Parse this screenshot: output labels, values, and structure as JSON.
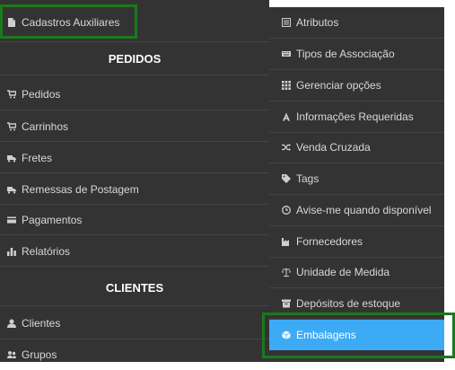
{
  "left_menu": {
    "top_item": {
      "label": "Cadastros Auxiliares",
      "icon": "document-icon"
    },
    "sections": [
      {
        "title": "PEDIDOS",
        "items": [
          {
            "label": "Pedidos",
            "icon": "cart-icon"
          },
          {
            "label": "Carrinhos",
            "icon": "cart-icon"
          },
          {
            "label": "Fretes",
            "icon": "truck-icon"
          },
          {
            "label": "Remessas de Postagem",
            "icon": "truck-icon"
          },
          {
            "label": "Pagamentos",
            "icon": "credit-card-icon"
          },
          {
            "label": "Relatórios",
            "icon": "bar-chart-icon"
          }
        ]
      },
      {
        "title": "CLIENTES",
        "items": [
          {
            "label": "Clientes",
            "icon": "user-icon"
          },
          {
            "label": "Grupos",
            "icon": "users-icon"
          }
        ]
      }
    ]
  },
  "submenu": {
    "items": [
      {
        "label": "Atributos",
        "icon": "list-icon"
      },
      {
        "label": "Tipos de Associação",
        "icon": "keyboard-icon"
      },
      {
        "label": "Gerenciar opções",
        "icon": "grid-icon"
      },
      {
        "label": "Informações Requeridas",
        "icon": "font-icon"
      },
      {
        "label": "Venda Cruzada",
        "icon": "shuffle-icon"
      },
      {
        "label": "Tags",
        "icon": "tag-icon"
      },
      {
        "label": "Avise-me quando disponível",
        "icon": "clock-icon"
      },
      {
        "label": "Fornecedores",
        "icon": "industry-icon"
      },
      {
        "label": "Unidade de Medida",
        "icon": "balance-scale-icon"
      },
      {
        "label": "Depósitos de estoque",
        "icon": "archive-icon"
      },
      {
        "label": "Embalagens",
        "icon": "cube-icon",
        "active": true
      }
    ]
  },
  "colors": {
    "menu_bg": "#333333",
    "text": "#d8d8d8",
    "active_bg": "#3daaf5",
    "highlight_border": "#1a7a1a"
  }
}
